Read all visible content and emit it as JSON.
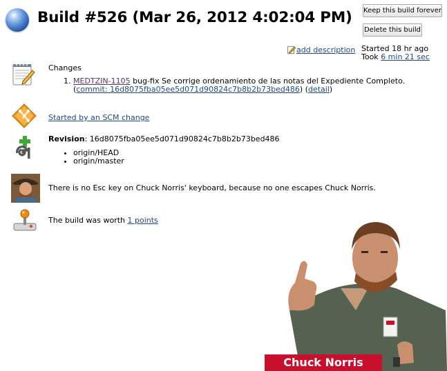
{
  "header": {
    "title": "Build #526 (Mar 26, 2012 4:02:04 PM)",
    "keep_button": "Keep this build forever",
    "delete_button": "Delete this build",
    "add_description": "add description",
    "started": "Started 18 hr ago",
    "took_prefix": "Took ",
    "took_duration": "6 min 21 sec"
  },
  "changes": {
    "heading": "Changes",
    "items": [
      {
        "number": "1.",
        "issue": "MEDTZIN-1105",
        "message": " bug-fix Se corrige ordenamiento de las notas del Expediente Completo.",
        "open_paren": "(",
        "commit": "commit: 16d8075fba05ee5d071d90824c7b8b2b73bed486",
        "mid": ") (",
        "detail": "detail",
        "close_paren": ")"
      }
    ]
  },
  "cause": {
    "text": "Started by an SCM change"
  },
  "git": {
    "revision_label": "Revision",
    "revision_sep": ": ",
    "revision": "16d8075fba05ee5d071d90824c7b8b2b73bed486",
    "branches": [
      "origin/HEAD",
      "origin/master"
    ]
  },
  "fact": {
    "text": "There is no Esc key on Chuck Norris' keyboard, because no one escapes Chuck Norris."
  },
  "worth": {
    "prefix": "The build was worth ",
    "points": "1 points"
  },
  "banner": {
    "text": "Chuck Norris"
  },
  "colors": {
    "link": "#204a87",
    "visited_link": "#5c3566",
    "banner": "#c8102e"
  }
}
